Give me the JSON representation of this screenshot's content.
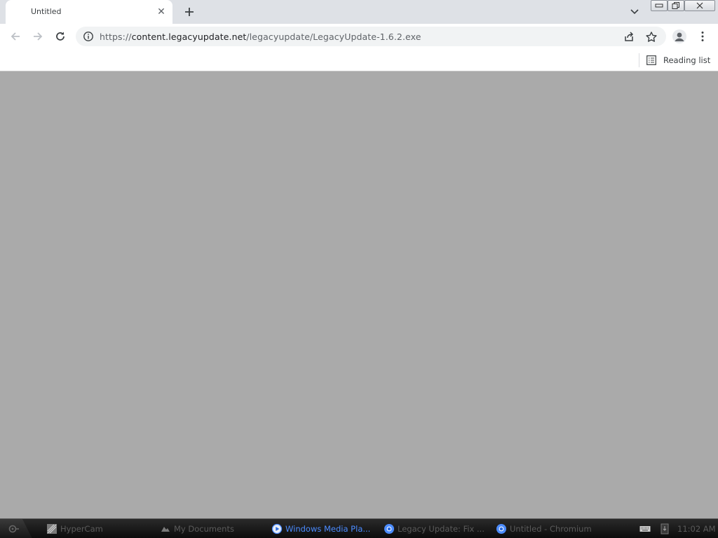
{
  "browser": {
    "tab": {
      "title": "Untitled"
    },
    "address_bar": {
      "url_scheme": "https://",
      "url_host": "content.legacyupdate.net",
      "url_path": "/legacyupdate/LegacyUpdate-1.6.2.exe"
    },
    "bookmarks_bar": {
      "reading_list_label": "Reading list"
    }
  },
  "taskbar": {
    "items": [
      {
        "label": "HyperCam",
        "icon": "hypercam-icon",
        "active": false
      },
      {
        "label": "My Documents",
        "icon": "folder-icon",
        "active": false
      },
      {
        "label": "Windows Media Pla...",
        "icon": "media-player-icon",
        "active": true
      },
      {
        "label": "Legacy Update: Fix ...",
        "icon": "chromium-icon",
        "active": false
      },
      {
        "label": "Untitled - Chromium",
        "icon": "chromium-icon",
        "active": false
      }
    ],
    "clock": "11:02 AM"
  },
  "colors": {
    "content_background": "#aaaaaa",
    "tabstrip_background": "#dee1e6",
    "active_task_text": "#4c8cff"
  }
}
